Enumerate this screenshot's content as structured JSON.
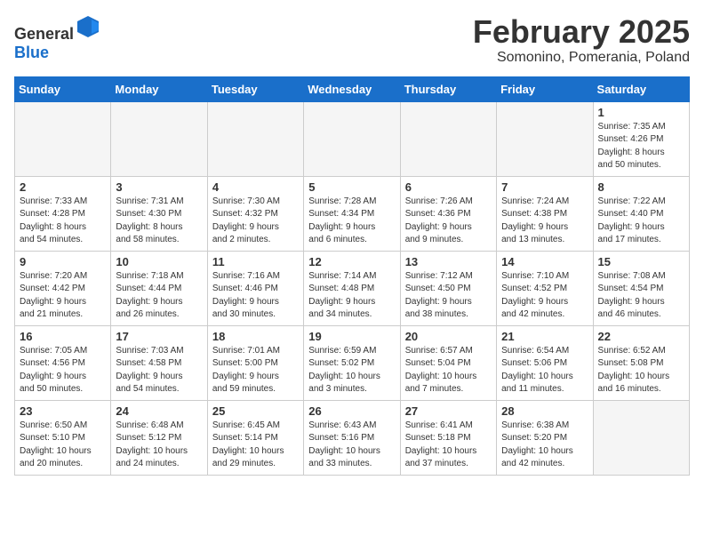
{
  "header": {
    "logo_general": "General",
    "logo_blue": "Blue",
    "month_title": "February 2025",
    "location": "Somonino, Pomerania, Poland"
  },
  "days_of_week": [
    "Sunday",
    "Monday",
    "Tuesday",
    "Wednesday",
    "Thursday",
    "Friday",
    "Saturday"
  ],
  "weeks": [
    [
      {
        "day": "",
        "info": ""
      },
      {
        "day": "",
        "info": ""
      },
      {
        "day": "",
        "info": ""
      },
      {
        "day": "",
        "info": ""
      },
      {
        "day": "",
        "info": ""
      },
      {
        "day": "",
        "info": ""
      },
      {
        "day": "1",
        "info": "Sunrise: 7:35 AM\nSunset: 4:26 PM\nDaylight: 8 hours\nand 50 minutes."
      }
    ],
    [
      {
        "day": "2",
        "info": "Sunrise: 7:33 AM\nSunset: 4:28 PM\nDaylight: 8 hours\nand 54 minutes."
      },
      {
        "day": "3",
        "info": "Sunrise: 7:31 AM\nSunset: 4:30 PM\nDaylight: 8 hours\nand 58 minutes."
      },
      {
        "day": "4",
        "info": "Sunrise: 7:30 AM\nSunset: 4:32 PM\nDaylight: 9 hours\nand 2 minutes."
      },
      {
        "day": "5",
        "info": "Sunrise: 7:28 AM\nSunset: 4:34 PM\nDaylight: 9 hours\nand 6 minutes."
      },
      {
        "day": "6",
        "info": "Sunrise: 7:26 AM\nSunset: 4:36 PM\nDaylight: 9 hours\nand 9 minutes."
      },
      {
        "day": "7",
        "info": "Sunrise: 7:24 AM\nSunset: 4:38 PM\nDaylight: 9 hours\nand 13 minutes."
      },
      {
        "day": "8",
        "info": "Sunrise: 7:22 AM\nSunset: 4:40 PM\nDaylight: 9 hours\nand 17 minutes."
      }
    ],
    [
      {
        "day": "9",
        "info": "Sunrise: 7:20 AM\nSunset: 4:42 PM\nDaylight: 9 hours\nand 21 minutes."
      },
      {
        "day": "10",
        "info": "Sunrise: 7:18 AM\nSunset: 4:44 PM\nDaylight: 9 hours\nand 26 minutes."
      },
      {
        "day": "11",
        "info": "Sunrise: 7:16 AM\nSunset: 4:46 PM\nDaylight: 9 hours\nand 30 minutes."
      },
      {
        "day": "12",
        "info": "Sunrise: 7:14 AM\nSunset: 4:48 PM\nDaylight: 9 hours\nand 34 minutes."
      },
      {
        "day": "13",
        "info": "Sunrise: 7:12 AM\nSunset: 4:50 PM\nDaylight: 9 hours\nand 38 minutes."
      },
      {
        "day": "14",
        "info": "Sunrise: 7:10 AM\nSunset: 4:52 PM\nDaylight: 9 hours\nand 42 minutes."
      },
      {
        "day": "15",
        "info": "Sunrise: 7:08 AM\nSunset: 4:54 PM\nDaylight: 9 hours\nand 46 minutes."
      }
    ],
    [
      {
        "day": "16",
        "info": "Sunrise: 7:05 AM\nSunset: 4:56 PM\nDaylight: 9 hours\nand 50 minutes."
      },
      {
        "day": "17",
        "info": "Sunrise: 7:03 AM\nSunset: 4:58 PM\nDaylight: 9 hours\nand 54 minutes."
      },
      {
        "day": "18",
        "info": "Sunrise: 7:01 AM\nSunset: 5:00 PM\nDaylight: 9 hours\nand 59 minutes."
      },
      {
        "day": "19",
        "info": "Sunrise: 6:59 AM\nSunset: 5:02 PM\nDaylight: 10 hours\nand 3 minutes."
      },
      {
        "day": "20",
        "info": "Sunrise: 6:57 AM\nSunset: 5:04 PM\nDaylight: 10 hours\nand 7 minutes."
      },
      {
        "day": "21",
        "info": "Sunrise: 6:54 AM\nSunset: 5:06 PM\nDaylight: 10 hours\nand 11 minutes."
      },
      {
        "day": "22",
        "info": "Sunrise: 6:52 AM\nSunset: 5:08 PM\nDaylight: 10 hours\nand 16 minutes."
      }
    ],
    [
      {
        "day": "23",
        "info": "Sunrise: 6:50 AM\nSunset: 5:10 PM\nDaylight: 10 hours\nand 20 minutes."
      },
      {
        "day": "24",
        "info": "Sunrise: 6:48 AM\nSunset: 5:12 PM\nDaylight: 10 hours\nand 24 minutes."
      },
      {
        "day": "25",
        "info": "Sunrise: 6:45 AM\nSunset: 5:14 PM\nDaylight: 10 hours\nand 29 minutes."
      },
      {
        "day": "26",
        "info": "Sunrise: 6:43 AM\nSunset: 5:16 PM\nDaylight: 10 hours\nand 33 minutes."
      },
      {
        "day": "27",
        "info": "Sunrise: 6:41 AM\nSunset: 5:18 PM\nDaylight: 10 hours\nand 37 minutes."
      },
      {
        "day": "28",
        "info": "Sunrise: 6:38 AM\nSunset: 5:20 PM\nDaylight: 10 hours\nand 42 minutes."
      },
      {
        "day": "",
        "info": ""
      }
    ]
  ]
}
